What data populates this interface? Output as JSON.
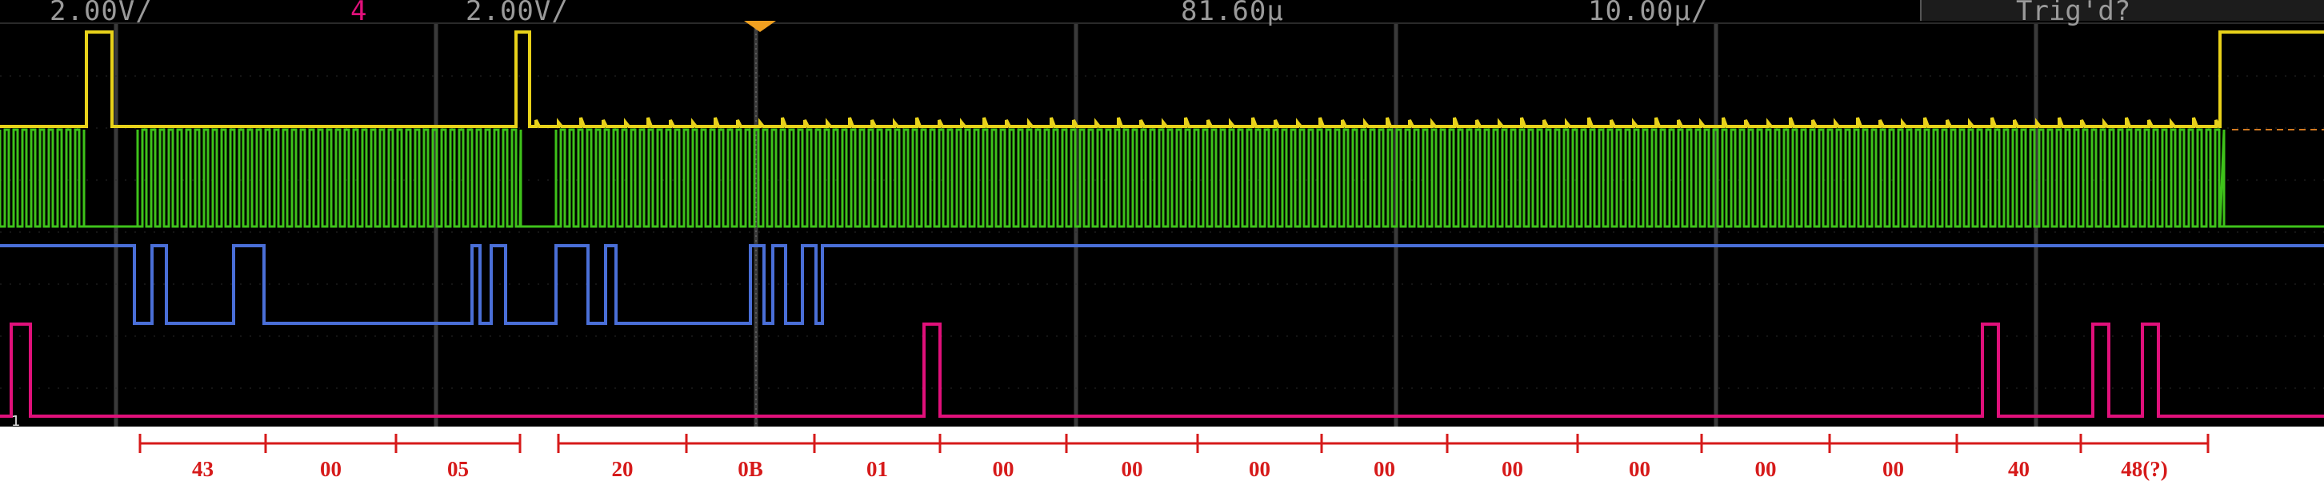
{
  "status": {
    "ch1_scale": "2.00V/",
    "ch4_num": "4",
    "ch4_scale": "2.00V/",
    "time_ref": "81.60µ",
    "time_scale": "10.00µ/",
    "trigger": "Trig'd?"
  },
  "marker": "1",
  "colors": {
    "ch1": "#e8d21a",
    "ch2": "#3ec21a",
    "ch3": "#4a6fd8",
    "ch4": "#e0107a",
    "decode": "#d61a1a"
  },
  "decode_bytes": [
    "43",
    "00",
    "05",
    "20",
    "0B",
    "01",
    "00",
    "00",
    "00",
    "00",
    "00",
    "00",
    "00",
    "00",
    "40",
    "48(?)"
  ]
}
